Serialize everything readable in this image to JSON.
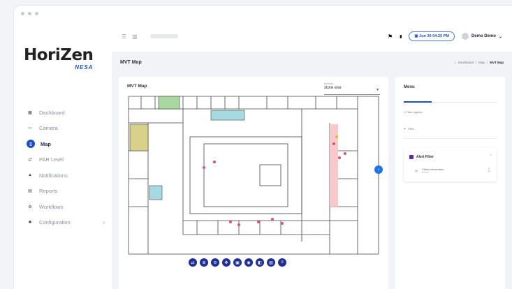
{
  "app": {
    "logo_main": "HoriZen",
    "logo_sub": "NESA"
  },
  "sidebar": {
    "items": [
      {
        "label": "Dashboard",
        "icon": "grid-icon"
      },
      {
        "label": "Camera",
        "icon": "camera-icon"
      },
      {
        "label": "Map",
        "icon": "map-icon",
        "active": true
      },
      {
        "label": "PAR Level",
        "icon": "swap-icon"
      },
      {
        "label": "Notifications",
        "icon": "bell-icon"
      },
      {
        "label": "Reports",
        "icon": "report-icon"
      },
      {
        "label": "Workflows",
        "icon": "workflow-icon"
      },
      {
        "label": "Configuration",
        "icon": "gear-icon",
        "expand": "›"
      }
    ]
  },
  "topbar": {
    "date": "Jun 30 04:25 PM",
    "user": "Demo Demo"
  },
  "page": {
    "title": "MVT Map",
    "breadcrumbs": [
      "Dashboard",
      "Map",
      "MVT Map"
    ]
  },
  "map_card": {
    "title": "MVT Map",
    "select_label": "Building",
    "select_value": "store exe",
    "tools": [
      "⇄",
      "⊕",
      "⊖",
      "✥",
      "▣",
      "◉",
      "◧",
      "▤",
      "≡"
    ]
  },
  "menu_card": {
    "title": "Menu",
    "tab_label": "2 Filter Applied",
    "filter_label": "Filter",
    "alert_filter": "Alert Filter",
    "item_title": "Class Information",
    "item_sub": "Default"
  },
  "colors": {
    "accent": "#1d4fc4",
    "toolbar": "#1f2f97",
    "room_green": "#a9d7a0",
    "room_yellow": "#d9d08a",
    "room_teal": "#a5dbe0",
    "room_pink": "#f6c9cc"
  }
}
